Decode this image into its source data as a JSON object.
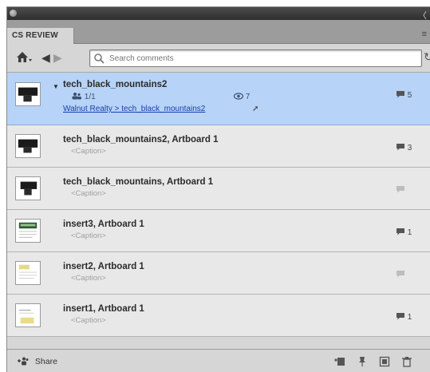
{
  "panel": {
    "tab_label": "CS REVIEW"
  },
  "toolbar": {
    "search_placeholder": "Search comments",
    "icons": [
      "home-icon",
      "back-arrow-icon",
      "forward-arrow-icon",
      "search-icon",
      "refresh-icon"
    ]
  },
  "review": {
    "title": "tech_black_mountains2",
    "participants": "1/1",
    "views": "7",
    "comments": "5",
    "breadcrumb": "Walnut Realty > tech_black_mountains2"
  },
  "items": [
    {
      "title": "tech_black_mountains2, Artboard 1",
      "caption": "<Caption>",
      "comments": "3",
      "has_comments": true,
      "thumb": "dark"
    },
    {
      "title": "tech_black_mountains, Artboard 1",
      "caption": "<Caption>",
      "comments": "",
      "has_comments": false,
      "thumb": "dark"
    },
    {
      "title": "insert3, Artboard 1",
      "caption": "<Caption>",
      "comments": "1",
      "has_comments": true,
      "thumb": "green"
    },
    {
      "title": "insert2, Artboard 1",
      "caption": "<Caption>",
      "comments": "",
      "has_comments": false,
      "thumb": "yellow"
    },
    {
      "title": "insert1, Artboard 1",
      "caption": "<Caption>",
      "comments": "1",
      "has_comments": true,
      "thumb": "yellow-bottom"
    }
  ],
  "bottom": {
    "share_label": "Share"
  }
}
